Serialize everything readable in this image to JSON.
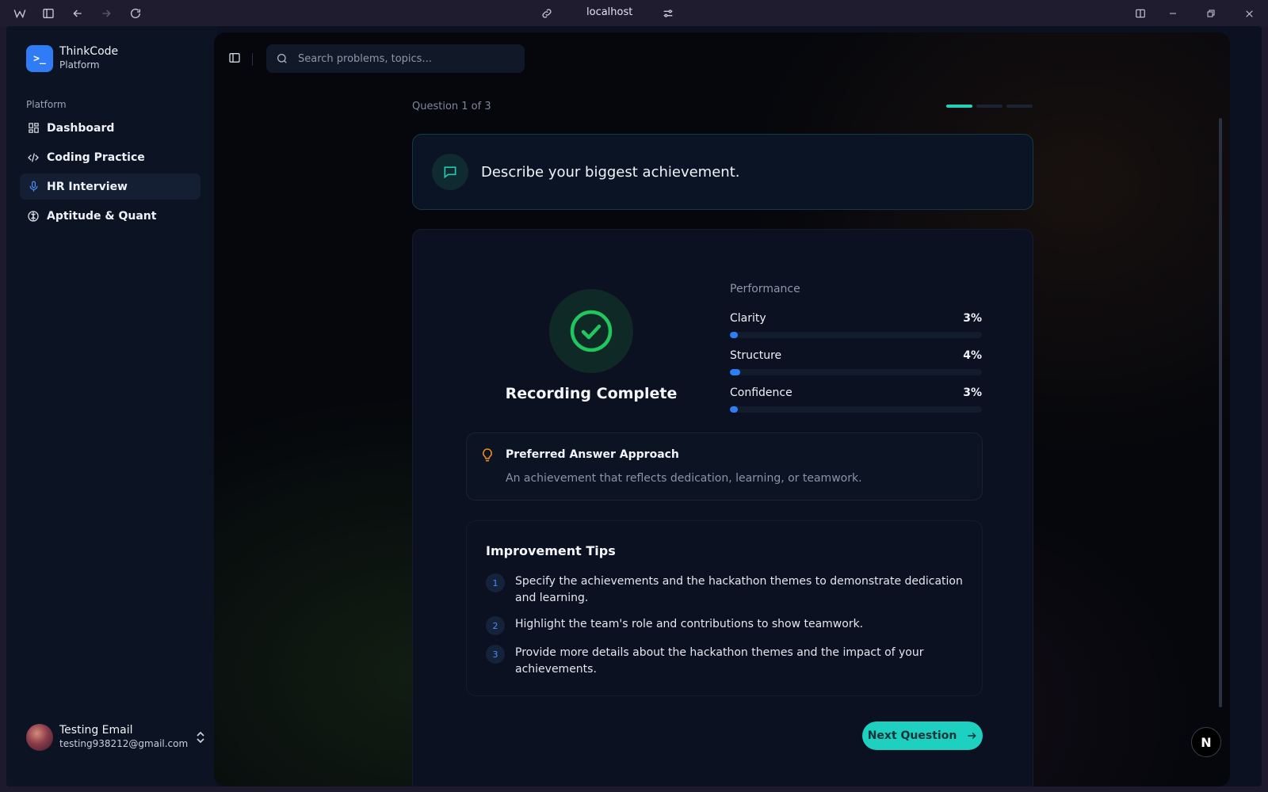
{
  "browser": {
    "address": "localhost"
  },
  "sidebar": {
    "brand_name": "ThinkCode",
    "brand_sub": "Platform",
    "brand_logo_text": ">_",
    "section_label": "Platform",
    "items": [
      {
        "label": "Dashboard",
        "icon": "dashboard-icon"
      },
      {
        "label": "Coding Practice",
        "icon": "code-icon"
      },
      {
        "label": "HR Interview",
        "icon": "microphone-icon",
        "active": true
      },
      {
        "label": "Aptitude & Quant",
        "icon": "brain-icon"
      }
    ],
    "user": {
      "name": "Testing Email",
      "email": "testing938212@gmail.com"
    }
  },
  "search": {
    "placeholder": "Search problems, topics..."
  },
  "interview": {
    "question_count": "Question 1 of 3",
    "progress": {
      "current": 1,
      "total": 3
    },
    "question": "Describe your biggest achievement.",
    "status": "Recording Complete",
    "performance_label": "Performance",
    "metrics": [
      {
        "name": "Clarity",
        "value": "3%",
        "fraction": 0.03
      },
      {
        "name": "Structure",
        "value": "4%",
        "fraction": 0.04
      },
      {
        "name": "Confidence",
        "value": "3%",
        "fraction": 0.03
      }
    ],
    "approach": {
      "title": "Preferred Answer Approach",
      "body": "An achievement that reflects dedication, learning, or teamwork."
    },
    "tips": {
      "title": "Improvement Tips",
      "items": [
        {
          "num": "1",
          "text": "Specify the achievements and the hackathon themes to demonstrate dedication and learning."
        },
        {
          "num": "2",
          "text": "Highlight the team's role and contributions to show teamwork."
        },
        {
          "num": "3",
          "text": "Provide more details about the hackathon themes and the impact of your achievements."
        }
      ]
    },
    "next_label": "Next Question"
  },
  "badge": {
    "label": "N"
  },
  "colors": {
    "accent": "#1ed0c0",
    "bar": "#2d7ff5",
    "success": "#22c55e",
    "tip_icon": "#f08a24"
  }
}
